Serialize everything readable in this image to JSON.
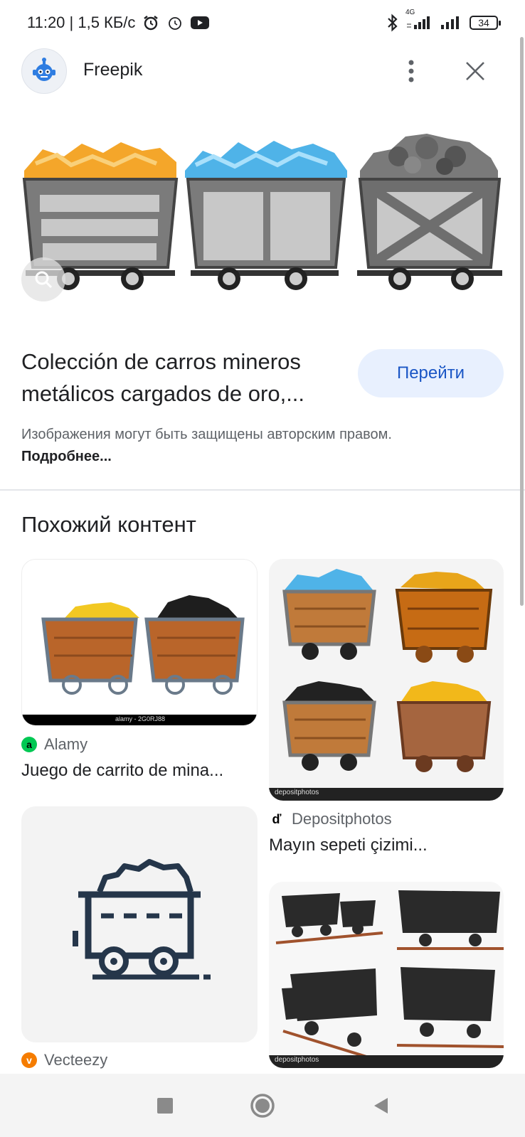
{
  "status_bar": {
    "time_speed": "11:20 | 1,5 КБ/с",
    "network": "4G",
    "battery": "34"
  },
  "header": {
    "source_name": "Freepik"
  },
  "result": {
    "title": "Colección de carros mineros metálicos cargados de oro,...",
    "visit_label": "Перейти",
    "copyright_text": "Изображения могут быть защищены авторским правом.",
    "more_link": "Подробнее..."
  },
  "similar": {
    "heading": "Похожий контент",
    "cards": [
      {
        "source": "Alamy",
        "title": "Juego de carrito de mina...",
        "watermark": "alamy - 2G0RJ88"
      },
      {
        "source": "Depositphotos",
        "title": "Mayın sepeti çizimi...",
        "watermark": "depositphotos"
      },
      {
        "source": "Vecteezy",
        "title": ""
      },
      {
        "source": "",
        "title": "",
        "watermark": "depositphotos"
      }
    ]
  },
  "colors": {
    "accent": "#1a56c5",
    "button_bg": "#e8f0fe",
    "alamy": "#00c853",
    "vecteezy": "#f57c00"
  }
}
